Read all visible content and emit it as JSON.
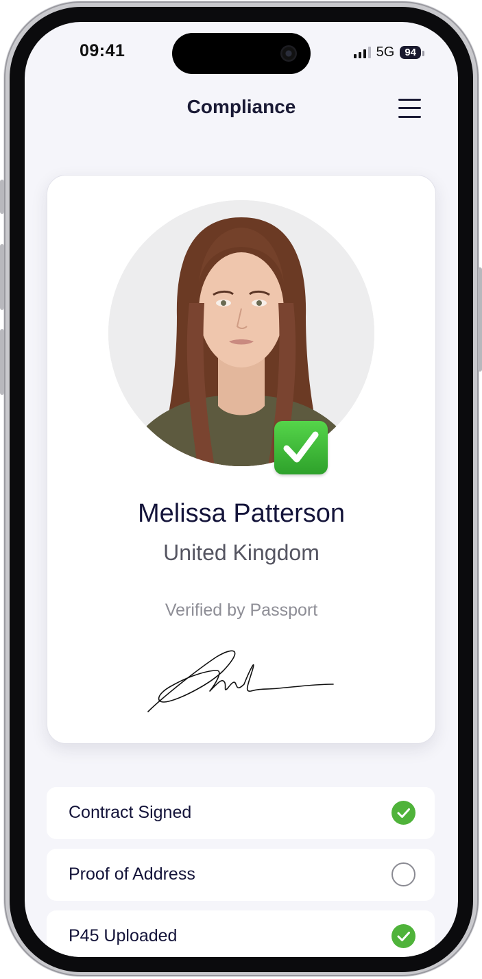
{
  "status_bar": {
    "time": "09:41",
    "network": "5G",
    "battery": "94"
  },
  "header": {
    "title": "Compliance"
  },
  "profile": {
    "name": "Melissa Patterson",
    "country": "United Kingdom",
    "verification": "Verified by Passport"
  },
  "checklist": [
    {
      "label": "Contract Signed",
      "done": true
    },
    {
      "label": "Proof of Address",
      "done": false
    },
    {
      "label": "P45 Uploaded",
      "done": true
    }
  ],
  "colors": {
    "accent_green": "#4fb33a",
    "title_navy": "#14143a",
    "background": "#f5f5fa"
  },
  "icons": [
    "signal-icon",
    "battery-icon",
    "menu-icon",
    "verified-check-icon",
    "check-circle-icon",
    "empty-circle-icon"
  ]
}
